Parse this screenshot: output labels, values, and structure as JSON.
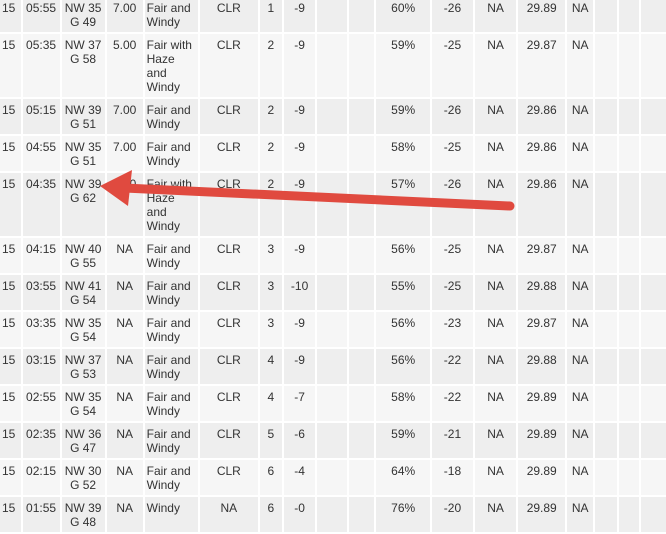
{
  "colors": {
    "arrow": "#e04a3f",
    "row_dark": "#eeeeee",
    "row_light": "#f6f6f6"
  },
  "annotation": {
    "type": "arrow",
    "points_to": "NW 39 G 62"
  },
  "rows": [
    {
      "day": "15",
      "time": "05:55",
      "wind": "NW 35 G 49",
      "vis": "7.00",
      "weather": "Fair and Windy",
      "sky": "CLR",
      "temp": "1",
      "dew": "-9",
      "c9": "",
      "c10": "",
      "humidity": "60%",
      "wind_chill": "-26",
      "heat_index": "NA",
      "pressure": "29.89",
      "precip": "NA",
      "c16": "",
      "c17": "",
      "c18": ""
    },
    {
      "day": "15",
      "time": "05:35",
      "wind": "NW 37 G 58",
      "vis": "5.00",
      "weather": "Fair with Haze and Windy",
      "sky": "CLR",
      "temp": "2",
      "dew": "-9",
      "c9": "",
      "c10": "",
      "humidity": "59%",
      "wind_chill": "-25",
      "heat_index": "NA",
      "pressure": "29.87",
      "precip": "NA",
      "c16": "",
      "c17": "",
      "c18": ""
    },
    {
      "day": "15",
      "time": "05:15",
      "wind": "NW 39 G 51",
      "vis": "7.00",
      "weather": "Fair and Windy",
      "sky": "CLR",
      "temp": "2",
      "dew": "-9",
      "c9": "",
      "c10": "",
      "humidity": "59%",
      "wind_chill": "-26",
      "heat_index": "NA",
      "pressure": "29.86",
      "precip": "NA",
      "c16": "",
      "c17": "",
      "c18": ""
    },
    {
      "day": "15",
      "time": "04:55",
      "wind": "NW 35 G 51",
      "vis": "7.00",
      "weather": "Fair and Windy",
      "sky": "CLR",
      "temp": "2",
      "dew": "-9",
      "c9": "",
      "c10": "",
      "humidity": "58%",
      "wind_chill": "-25",
      "heat_index": "NA",
      "pressure": "29.86",
      "precip": "NA",
      "c16": "",
      "c17": "",
      "c18": ""
    },
    {
      "day": "15",
      "time": "04:35",
      "wind": "NW 39 G 62",
      "vis": "5.00",
      "weather": "Fair with Haze and Windy",
      "sky": "CLR",
      "temp": "2",
      "dew": "-9",
      "c9": "",
      "c10": "",
      "humidity": "57%",
      "wind_chill": "-26",
      "heat_index": "NA",
      "pressure": "29.86",
      "precip": "NA",
      "c16": "",
      "c17": "",
      "c18": ""
    },
    {
      "day": "15",
      "time": "04:15",
      "wind": "NW 40 G 55",
      "vis": "NA",
      "weather": "Fair and Windy",
      "sky": "CLR",
      "temp": "3",
      "dew": "-9",
      "c9": "",
      "c10": "",
      "humidity": "56%",
      "wind_chill": "-25",
      "heat_index": "NA",
      "pressure": "29.87",
      "precip": "NA",
      "c16": "",
      "c17": "",
      "c18": ""
    },
    {
      "day": "15",
      "time": "03:55",
      "wind": "NW 41 G 54",
      "vis": "NA",
      "weather": "Fair and Windy",
      "sky": "CLR",
      "temp": "3",
      "dew": "-10",
      "c9": "",
      "c10": "",
      "humidity": "55%",
      "wind_chill": "-25",
      "heat_index": "NA",
      "pressure": "29.88",
      "precip": "NA",
      "c16": "",
      "c17": "",
      "c18": ""
    },
    {
      "day": "15",
      "time": "03:35",
      "wind": "NW 35 G 54",
      "vis": "NA",
      "weather": "Fair and Windy",
      "sky": "CLR",
      "temp": "3",
      "dew": "-9",
      "c9": "",
      "c10": "",
      "humidity": "56%",
      "wind_chill": "-23",
      "heat_index": "NA",
      "pressure": "29.87",
      "precip": "NA",
      "c16": "",
      "c17": "",
      "c18": ""
    },
    {
      "day": "15",
      "time": "03:15",
      "wind": "NW 37 G 53",
      "vis": "NA",
      "weather": "Fair and Windy",
      "sky": "CLR",
      "temp": "4",
      "dew": "-9",
      "c9": "",
      "c10": "",
      "humidity": "56%",
      "wind_chill": "-22",
      "heat_index": "NA",
      "pressure": "29.88",
      "precip": "NA",
      "c16": "",
      "c17": "",
      "c18": ""
    },
    {
      "day": "15",
      "time": "02:55",
      "wind": "NW 35 G 54",
      "vis": "NA",
      "weather": "Fair and Windy",
      "sky": "CLR",
      "temp": "4",
      "dew": "-7",
      "c9": "",
      "c10": "",
      "humidity": "58%",
      "wind_chill": "-22",
      "heat_index": "NA",
      "pressure": "29.89",
      "precip": "NA",
      "c16": "",
      "c17": "",
      "c18": ""
    },
    {
      "day": "15",
      "time": "02:35",
      "wind": "NW 36 G 47",
      "vis": "NA",
      "weather": "Fair and Windy",
      "sky": "CLR",
      "temp": "5",
      "dew": "-6",
      "c9": "",
      "c10": "",
      "humidity": "59%",
      "wind_chill": "-21",
      "heat_index": "NA",
      "pressure": "29.89",
      "precip": "NA",
      "c16": "",
      "c17": "",
      "c18": ""
    },
    {
      "day": "15",
      "time": "02:15",
      "wind": "NW 30 G 52",
      "vis": "NA",
      "weather": "Fair and Windy",
      "sky": "CLR",
      "temp": "6",
      "dew": "-4",
      "c9": "",
      "c10": "",
      "humidity": "64%",
      "wind_chill": "-18",
      "heat_index": "NA",
      "pressure": "29.89",
      "precip": "NA",
      "c16": "",
      "c17": "",
      "c18": ""
    },
    {
      "day": "15",
      "time": "01:55",
      "wind": "NW 39 G 48",
      "vis": "NA",
      "weather": "Windy",
      "sky": "NA",
      "temp": "6",
      "dew": "-0",
      "c9": "",
      "c10": "",
      "humidity": "76%",
      "wind_chill": "-20",
      "heat_index": "NA",
      "pressure": "29.89",
      "precip": "NA",
      "c16": "",
      "c17": "",
      "c18": ""
    }
  ]
}
